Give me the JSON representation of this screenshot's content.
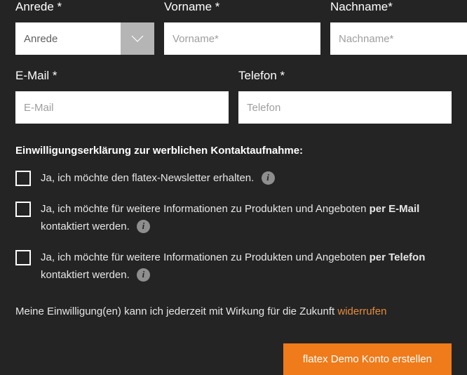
{
  "fields": {
    "anrede": {
      "label": "Anrede *",
      "value": "Anrede"
    },
    "vorname": {
      "label": "Vorname *",
      "placeholder": "Vorname*"
    },
    "nachname": {
      "label": "Nachname*",
      "placeholder": "Nachname*"
    },
    "email": {
      "label": "E-Mail *",
      "placeholder": "E-Mail"
    },
    "telefon": {
      "label": "Telefon *",
      "placeholder": "Telefon"
    }
  },
  "consent": {
    "heading": "Einwilligungserklärung zur werblichen Kontaktaufnahme:",
    "newsletter": "Ja, ich möchte den flatex-Newsletter erhalten.",
    "emailInfo_pre": "Ja, ich möchte für weitere Informationen zu Produkten und Angeboten ",
    "emailInfo_bold": "per E-Mail",
    "emailInfo_post": " kontaktiert werden.",
    "phoneInfo_pre": "Ja, ich möchte für weitere Informationen zu Produkten und Angeboten ",
    "phoneInfo_bold": "per Telefon",
    "phoneInfo_post": " kontaktiert werden."
  },
  "revoke": {
    "text": "Meine Einwilligung(en) kann ich jederzeit mit Wirkung für die Zukunft ",
    "link": "widerrufen"
  },
  "submit": "flatex Demo Konto erstellen",
  "info_glyph": "i"
}
